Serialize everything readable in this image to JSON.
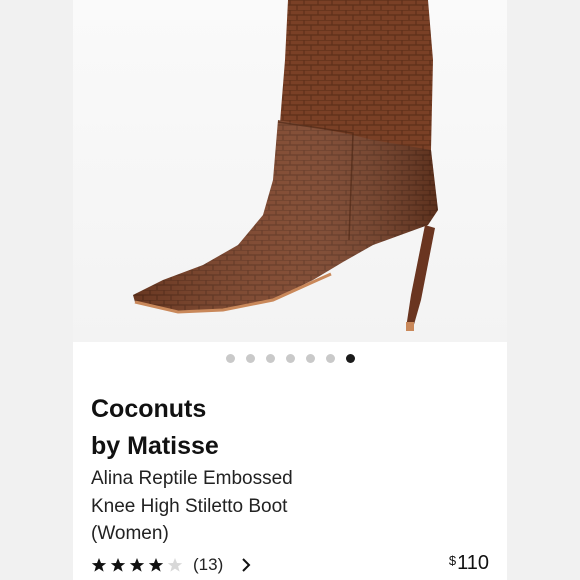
{
  "product": {
    "brand_line1": "Coconuts",
    "brand_line2": "by Matisse",
    "title_line1": "Alina Reptile Embossed",
    "title_line2": "Knee High Stiletto Boot",
    "title_line3": "(Women)",
    "rating_value": 4,
    "rating_max": 5,
    "review_count": "(13)",
    "price_currency": "$",
    "price_amount": "110"
  },
  "carousel": {
    "total": 7,
    "active_index": 6
  },
  "colors": {
    "boot": "#7a4026",
    "boot_dark": "#5a2c18",
    "star": "#111111",
    "star_empty": "#d8d8d8",
    "dot": "#c9c9c9",
    "dot_active": "#1a1a1a"
  },
  "icons": {
    "star": "star-icon",
    "chevron": "chevron-right-icon"
  }
}
